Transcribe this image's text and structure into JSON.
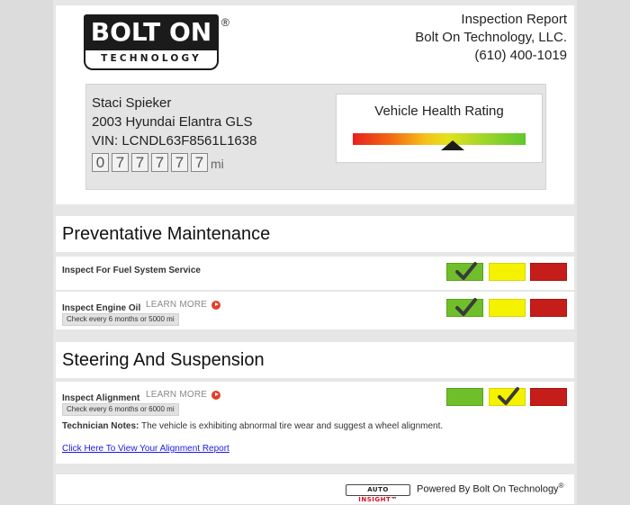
{
  "header": {
    "logo_top": "BOLT ON",
    "logo_bottom": "TECHNOLOGY",
    "logo_reg": "®",
    "report_title": "Inspection Report",
    "company_name": "Bolt On Technology, LLC.",
    "phone": "(610) 400-1019"
  },
  "vehicle": {
    "owner": "Staci Spieker",
    "model": "2003 Hyundai Elantra GLS",
    "vin": "VIN: LCNDL63F8561L1638",
    "odometer_digits": [
      "0",
      "7",
      "7",
      "7",
      "7",
      "7"
    ],
    "odometer_unit": "mi"
  },
  "health": {
    "title": "Vehicle Health Rating",
    "rating_fraction": 0.58
  },
  "sections": [
    {
      "title": "Preventative Maintenance",
      "items": [
        {
          "name": "Inspect For Fuel System Service",
          "status": "green"
        },
        {
          "name": "Inspect Engine Oil",
          "learn_more": "LEARN MORE",
          "interval": "Check every 6 months or 5000 mi",
          "status": "green"
        }
      ]
    },
    {
      "title": "Steering And Suspension",
      "items": [
        {
          "name": "Inspect Alignment",
          "learn_more": "LEARN MORE",
          "interval": "Check every 6 months or 6000 mi",
          "status": "yellow",
          "notes_label": "Technician Notes:",
          "notes_text": " The vehicle is exhibiting abnormal tire wear and suggest a wheel alignment.",
          "link_text": "Click Here To View Your Alignment Report"
        }
      ]
    }
  ],
  "footer": {
    "autoinsight_a": "AUTO",
    "autoinsight_b": "INSIGHT",
    "autoinsight_tm": "™",
    "powered_by": "Powered By Bolt On Technology",
    "powered_reg": "®"
  },
  "colors": {
    "status_green": "#6fbf2b",
    "status_yellow": "#f5f200",
    "status_red": "#c41d1a"
  }
}
